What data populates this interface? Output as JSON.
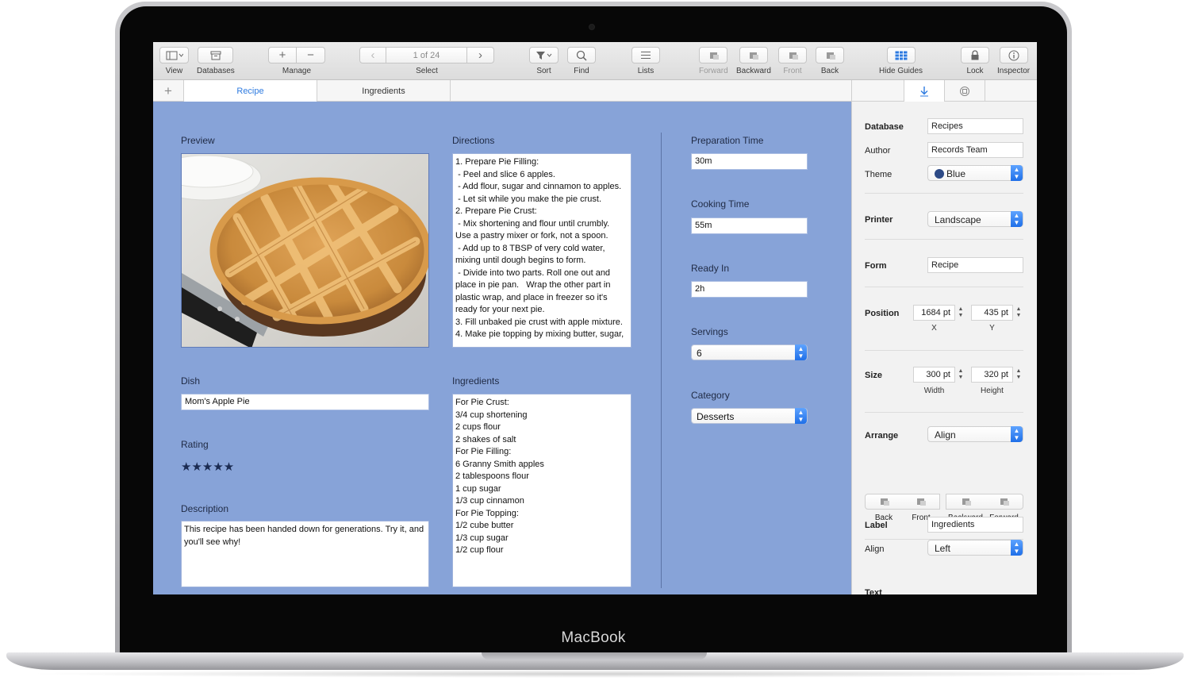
{
  "device": {
    "brand": "MacBook"
  },
  "toolbar": {
    "view": "View",
    "databases": "Databases",
    "manage": "Manage",
    "add_symbol": "+",
    "remove_symbol": "−",
    "record_counter": "1 of 24",
    "select": "Select",
    "sort": "Sort",
    "find": "Find",
    "lists": "Lists",
    "forward": "Forward",
    "backward": "Backward",
    "front": "Front",
    "back": "Back",
    "hide_guides": "Hide Guides",
    "lock": "Lock",
    "inspector": "Inspector"
  },
  "tabs": {
    "add_symbol": "+",
    "items": [
      "Recipe",
      "Ingredients"
    ],
    "active": "Recipe"
  },
  "form": {
    "preview_label": "Preview",
    "dish_label": "Dish",
    "dish_value": "Mom's Apple Pie",
    "rating_label": "Rating",
    "rating": 5,
    "rating_stars": "★★★★★",
    "description_label": "Description",
    "description_value": "This recipe has been handed down for generations. Try it, and you'll see why!",
    "directions_label": "Directions",
    "directions_value": "1. Prepare Pie Filling:\n - Peel and slice 6 apples.\n - Add flour, sugar and cinnamon to apples.\n - Let sit while you make the pie crust.\n2. Prepare Pie Crust:\n - Mix shortening and flour until crumbly.\nUse a pastry mixer or fork, not a spoon.\n - Add up to 8 TBSP of very cold water,\nmixing until dough begins to form.\n - Divide into two parts. Roll one out and\nplace in pie pan.   Wrap the other part in\nplastic wrap, and place in freezer so it's\nready for your next pie.\n3. Fill unbaked pie crust with apple mixture.\n4. Make pie topping by mixing butter, sugar,",
    "ingredients_label": "Ingredients",
    "ingredients_value": "For Pie Crust:\n3/4 cup shortening\n2 cups flour\n2 shakes of salt\nFor Pie Filling:\n6 Granny Smith apples\n2 tablespoons flour\n1 cup sugar\n1/3 cup cinnamon\nFor Pie Topping:\n1/2 cube butter\n1/3 cup sugar\n1/2 cup flour",
    "prep_time_label": "Preparation Time",
    "prep_time_value": "30m",
    "cooking_time_label": "Cooking Time",
    "cooking_time_value": "55m",
    "ready_in_label": "Ready In",
    "ready_in_value": "2h",
    "servings_label": "Servings",
    "servings_value": "6",
    "category_label": "Category",
    "category_value": "Desserts"
  },
  "inspector": {
    "database_label": "Database",
    "database_value": "Recipes",
    "author_label": "Author",
    "author_value": "Records Team",
    "theme_label": "Theme",
    "theme_value": "Blue",
    "theme_color": "#2d4a86",
    "printer_label": "Printer",
    "printer_value": "Landscape",
    "form_label": "Form",
    "form_value": "Recipe",
    "position_label": "Position",
    "position_x": "1684 pt",
    "position_y": "435 pt",
    "x_label": "X",
    "y_label": "Y",
    "size_label": "Size",
    "width_value": "300 pt",
    "height_value": "320 pt",
    "width_label": "Width",
    "height_label": "Height",
    "arrange_label": "Arrange",
    "arrange_value": "Align",
    "arrange_buttons": [
      "Back",
      "Front",
      "Backward",
      "Forward"
    ],
    "label_label": "Label",
    "label_value": "Ingredients",
    "align_label": "Align",
    "align_value": "Left",
    "text_label": "Text"
  },
  "colors": {
    "accent": "#2e7be0",
    "canvas": "#87a3d8"
  }
}
